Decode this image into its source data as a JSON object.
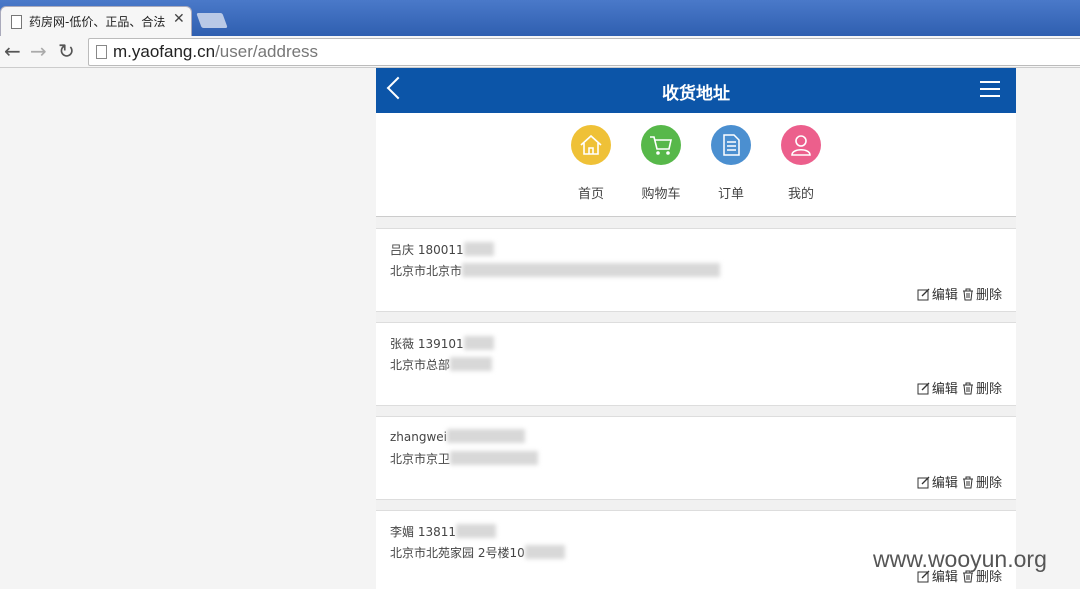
{
  "browser": {
    "tab_title": "药房网-低价、正品、合法",
    "url_host": "m.yaofang.cn",
    "url_path": "/user/address"
  },
  "header": {
    "title": "收货地址"
  },
  "quick_nav": [
    {
      "label": "首页",
      "icon": "home-icon"
    },
    {
      "label": "购物车",
      "icon": "cart-icon"
    },
    {
      "label": "订单",
      "icon": "order-icon"
    },
    {
      "label": "我的",
      "icon": "user-icon"
    }
  ],
  "addresses": [
    {
      "name": "吕庆 180011",
      "line": "北京市北京市"
    },
    {
      "name": "张薇 139101",
      "line": "北京市总部"
    },
    {
      "name": "zhangwei",
      "line": "北京市京卫"
    },
    {
      "name": "李媚 13811",
      "line": "北京市北苑家园 2号楼10"
    }
  ],
  "actions": {
    "edit": "编辑",
    "delete": "删除"
  },
  "watermark": "www.wooyun.org",
  "colors": {
    "header": "#0c55a8",
    "home": "#efc137",
    "cart": "#57b84a",
    "order": "#4b8fd0",
    "me": "#ec5f8c"
  }
}
